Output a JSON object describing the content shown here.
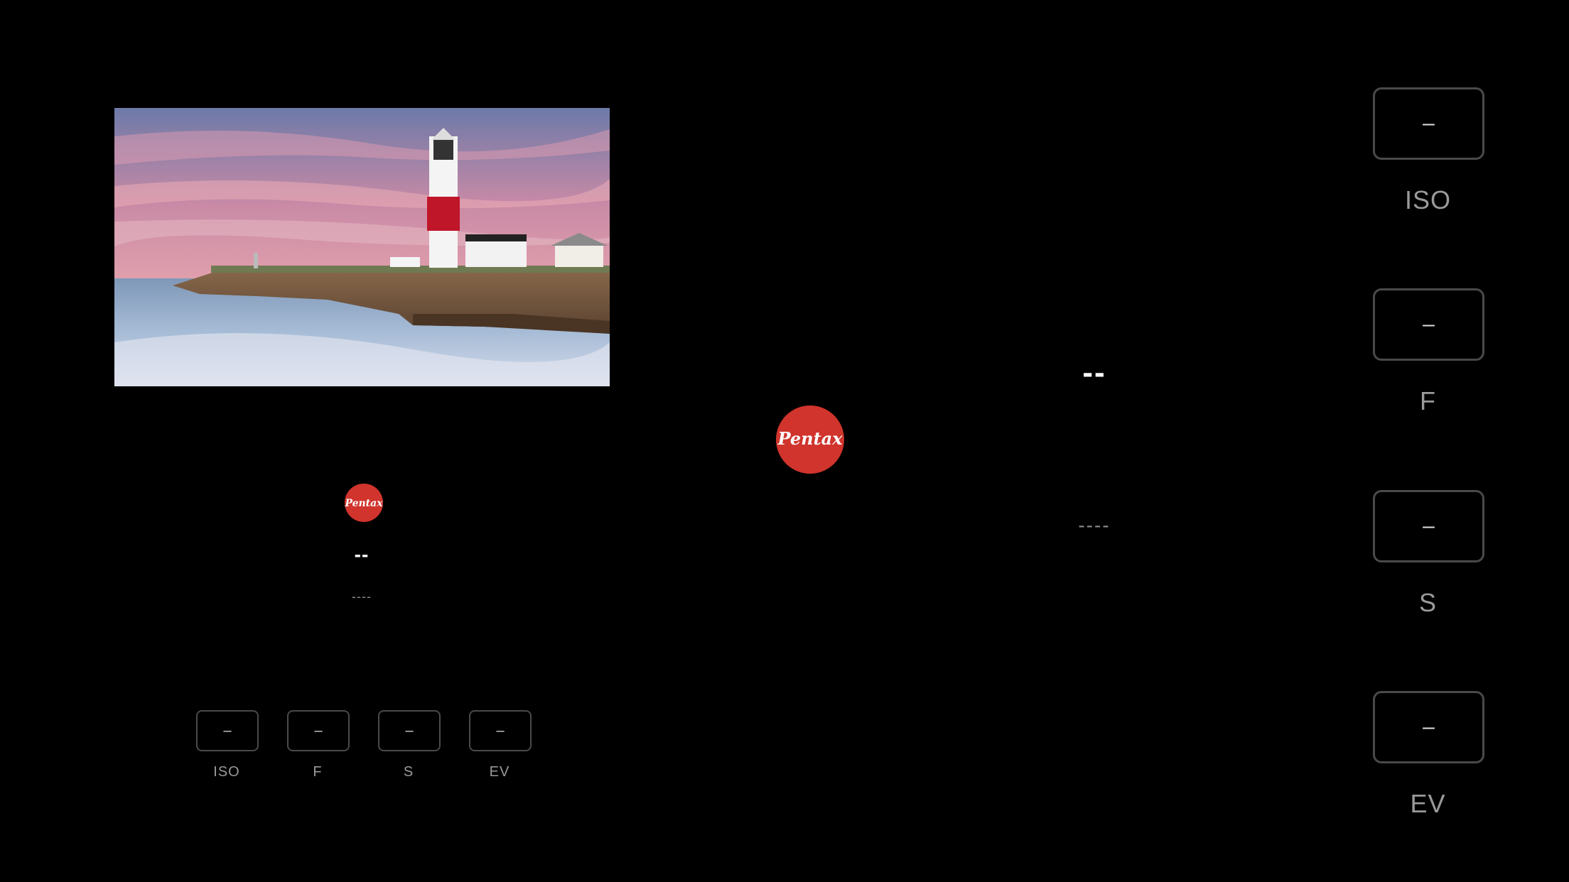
{
  "brand": {
    "logo_text": "Pentax",
    "logo_color": "#d0342c"
  },
  "preview": {
    "icon": "lighthouse-photo"
  },
  "compact_panel": {
    "main_value": "--",
    "sub_value": "----",
    "controls": [
      {
        "value": "–",
        "label": "ISO"
      },
      {
        "value": "–",
        "label": "F"
      },
      {
        "value": "–",
        "label": "S"
      },
      {
        "value": "–",
        "label": "EV"
      }
    ]
  },
  "readout": {
    "main_value": "--",
    "sub_value": "----"
  },
  "controls": [
    {
      "value": "–",
      "label": "ISO"
    },
    {
      "value": "–",
      "label": "F"
    },
    {
      "value": "–",
      "label": "S"
    },
    {
      "value": "–",
      "label": "EV"
    }
  ]
}
